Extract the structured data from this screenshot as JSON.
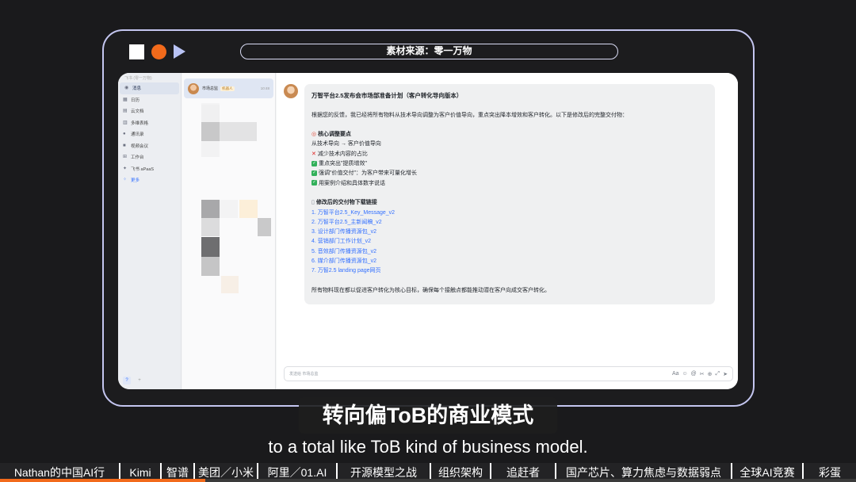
{
  "source_label": "素材来源：零一万物",
  "sidebar": {
    "top_label": "飞书 (零一万物)",
    "items": [
      {
        "icon": "chat",
        "label": "消息"
      },
      {
        "icon": "calendar",
        "label": "日历"
      },
      {
        "icon": "doc",
        "label": "云文档"
      },
      {
        "icon": "table",
        "label": "多维表格"
      },
      {
        "icon": "contacts",
        "label": "通讯录"
      },
      {
        "icon": "video",
        "label": "视频会议"
      },
      {
        "icon": "grid",
        "label": "工作台"
      },
      {
        "icon": "apaas",
        "label": "飞书 aPaaS"
      },
      {
        "icon": "more",
        "label": "更多"
      }
    ]
  },
  "chat_list": {
    "active": {
      "name": "市场总监",
      "tag": "机器人",
      "time": "10:48"
    }
  },
  "message": {
    "title": "万智平台2.5发布会市场部准备计划（客户转化导向版本）",
    "intro": "根据您的反馈，我已经将所有物料从技术导向调整为客户价值导向，重点突出降本增效和客户转化。以下是修改后的完整交付物：",
    "core_header": "核心调整要点",
    "core_sub": "从技术导向 → 客户价值导向",
    "core_points": [
      {
        "icon": "cross",
        "text": "减少技术内容的占比"
      },
      {
        "icon": "check",
        "text": "重点突出\"提质增效\""
      },
      {
        "icon": "check",
        "text": "强调\"价值交付\"：为客户带来可量化增长"
      },
      {
        "icon": "check",
        "text": "用案例介绍和具体数字说话"
      }
    ],
    "links_header": "修改后的交付物下载链接",
    "links": [
      "1. 万智平台2.5_Key_Message_v2",
      "2. 万智平台2.5_主新闻稿_v2",
      "3. 设计部门传播资源包_v2",
      "4. 营销部门工作计划_v2",
      "5. 音效部门传播资源包_v2",
      "6. 媒介部门传播资源包_v2",
      "7. 万智2.5 landing page网页"
    ],
    "closing": "所有物料现在都以促进客户转化为核心目标，确保每个接触点都能推动潜在客户向成交客户转化。"
  },
  "composer": {
    "placeholder": "发送给 市场总监"
  },
  "subtitle_cn": "转向偏ToB的商业模式",
  "subtitle_en": "to a total like ToB kind of business model.",
  "topics": [
    "Nathan的中国AI行",
    "Kimi",
    "智谱",
    "美团／小米",
    "阿里／01.AI",
    "开源模型之战",
    "组织架构",
    "追赶者",
    "国产芯片、算力焦虑与数据弱点",
    "全球AI竞赛",
    "彩蛋"
  ],
  "progress": 0.24,
  "colors": {
    "accent": "#f26a1b",
    "link": "#3370ff",
    "frame": "#c4c6f0"
  }
}
